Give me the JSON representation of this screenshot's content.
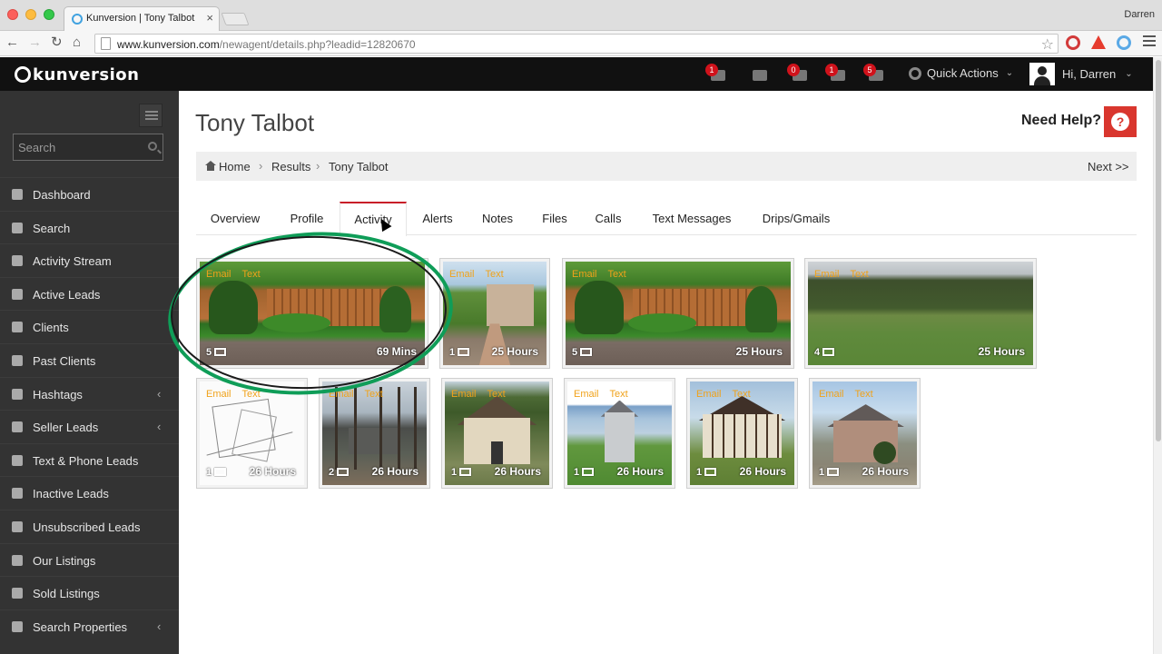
{
  "browser": {
    "tab_title": "Kunversion | Tony Talbot",
    "tab_close": "×",
    "profile_name": "Darren",
    "url_host": "www.kunversion.com",
    "url_path": "/newagent/details.php?leadid=12820670",
    "nav": {
      "back": "←",
      "forward": "→",
      "reload": "↻",
      "home": "⌂",
      "star": "☆"
    }
  },
  "app": {
    "logo_text": "kunversion",
    "header_badges": {
      "alerts": "1",
      "messages": "0",
      "chats": "1",
      "feeds": "5"
    },
    "quick_actions_label": "Quick Actions",
    "user_greeting": "Hi, Darren",
    "chevron": "⌄"
  },
  "sidebar": {
    "search_placeholder": "Search",
    "items": [
      {
        "label": "Dashboard",
        "icon": "dashboard-icon",
        "caret": ""
      },
      {
        "label": "Search",
        "icon": "search-icon",
        "caret": ""
      },
      {
        "label": "Activity Stream",
        "icon": "image-icon",
        "caret": ""
      },
      {
        "label": "Active Leads",
        "icon": "thumbs-up-icon",
        "caret": ""
      },
      {
        "label": "Clients",
        "icon": "user-icon",
        "caret": ""
      },
      {
        "label": "Past Clients",
        "icon": "user-icon",
        "caret": ""
      },
      {
        "label": "Hashtags",
        "icon": "folder-icon",
        "caret": "‹"
      },
      {
        "label": "Seller Leads",
        "icon": "list-icon",
        "caret": "‹"
      },
      {
        "label": "Text & Phone Leads",
        "icon": "image-icon",
        "caret": ""
      },
      {
        "label": "Inactive Leads",
        "icon": "thumbs-down-icon",
        "caret": ""
      },
      {
        "label": "Unsubscribed Leads",
        "icon": "trash-icon",
        "caret": ""
      },
      {
        "label": "Our Listings",
        "icon": "gear-icon",
        "caret": ""
      },
      {
        "label": "Sold Listings",
        "icon": "tag-icon",
        "caret": ""
      },
      {
        "label": "Search Properties",
        "icon": "map-marker-icon",
        "caret": "‹"
      }
    ]
  },
  "page": {
    "title": "Tony Talbot",
    "need_help": "Need Help?",
    "help_glyph": "?",
    "breadcrumb": {
      "home": "Home",
      "results": "Results",
      "current": "Tony Talbot",
      "sep": "›",
      "next": "Next >>"
    },
    "tabs": [
      "Overview",
      "Profile",
      "Activity",
      "Alerts",
      "Notes",
      "Files",
      "Calls",
      "Text Messages",
      "Drips/Gmails"
    ],
    "active_tab": "Activity"
  },
  "activity": {
    "email_label": "Email",
    "text_label": "Text",
    "cards": [
      {
        "count": "5",
        "duration": "69 Mins",
        "photo": "backyard"
      },
      {
        "count": "1",
        "duration": "25 Hours",
        "photo": "walkway"
      },
      {
        "count": "5",
        "duration": "25 Hours",
        "photo": "backyard"
      },
      {
        "count": "4",
        "duration": "25 Hours",
        "photo": "field"
      },
      {
        "count": "1",
        "duration": "26 Hours",
        "photo": "plat-map"
      },
      {
        "count": "2",
        "duration": "26 Hours",
        "photo": "wooded-lot"
      },
      {
        "count": "1",
        "duration": "26 Hours",
        "photo": "cottage"
      },
      {
        "count": "1",
        "duration": "26 Hours",
        "photo": "gray-house"
      },
      {
        "count": "1",
        "duration": "26 Hours",
        "photo": "tudor-house"
      },
      {
        "count": "1",
        "duration": "26 Hours",
        "photo": "brick-ranch"
      }
    ]
  },
  "colors": {
    "accent_red": "#c81e28",
    "badge_red": "#d0121b",
    "label_orange": "#f0a21a",
    "annotation_green": "#0f9d58"
  }
}
